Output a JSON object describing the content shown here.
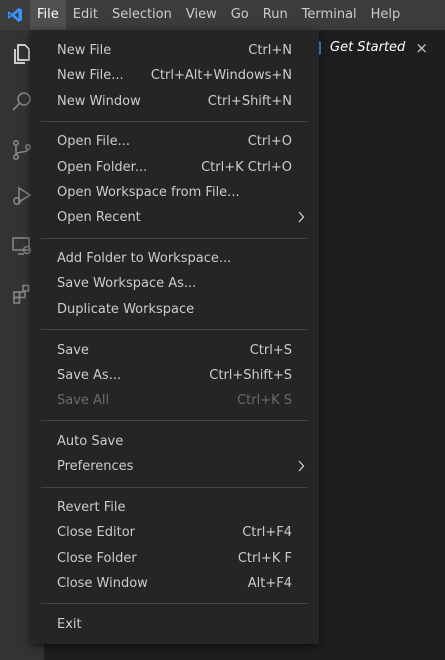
{
  "colors": {
    "accent": "#3794ff",
    "menubar_bg": "#3c3c3c",
    "menu_bg": "#252526",
    "activitybar_bg": "#333333",
    "text": "#cccccc",
    "disabled_text": "#6b6b6b"
  },
  "menubar": {
    "items": [
      "File",
      "Edit",
      "Selection",
      "View",
      "Go",
      "Run",
      "Terminal",
      "Help"
    ],
    "active": "File"
  },
  "activitybar": {
    "icons": [
      "explorer-icon",
      "search-icon",
      "source-control-icon",
      "run-debug-icon",
      "remote-explorer-icon",
      "extensions-icon"
    ]
  },
  "tab": {
    "title": "Get Started",
    "close": "×"
  },
  "file_menu": {
    "groups": [
      [
        {
          "label": "New File",
          "shortcut": "Ctrl+N"
        },
        {
          "label": "New File...",
          "shortcut": "Ctrl+Alt+Windows+N"
        },
        {
          "label": "New Window",
          "shortcut": "Ctrl+Shift+N"
        }
      ],
      [
        {
          "label": "Open File...",
          "shortcut": "Ctrl+O"
        },
        {
          "label": "Open Folder...",
          "shortcut": "Ctrl+K Ctrl+O"
        },
        {
          "label": "Open Workspace from File...",
          "shortcut": ""
        },
        {
          "label": "Open Recent",
          "shortcut": "",
          "submenu": true
        }
      ],
      [
        {
          "label": "Add Folder to Workspace...",
          "shortcut": ""
        },
        {
          "label": "Save Workspace As...",
          "shortcut": ""
        },
        {
          "label": "Duplicate Workspace",
          "shortcut": ""
        }
      ],
      [
        {
          "label": "Save",
          "shortcut": "Ctrl+S"
        },
        {
          "label": "Save As...",
          "shortcut": "Ctrl+Shift+S"
        },
        {
          "label": "Save All",
          "shortcut": "Ctrl+K S",
          "disabled": true
        }
      ],
      [
        {
          "label": "Auto Save",
          "shortcut": ""
        },
        {
          "label": "Preferences",
          "shortcut": "",
          "submenu": true
        }
      ],
      [
        {
          "label": "Revert File",
          "shortcut": ""
        },
        {
          "label": "Close Editor",
          "shortcut": "Ctrl+F4"
        },
        {
          "label": "Close Folder",
          "shortcut": "Ctrl+K F"
        },
        {
          "label": "Close Window",
          "shortcut": "Alt+F4"
        }
      ],
      [
        {
          "label": "Exit",
          "shortcut": ""
        }
      ]
    ]
  }
}
